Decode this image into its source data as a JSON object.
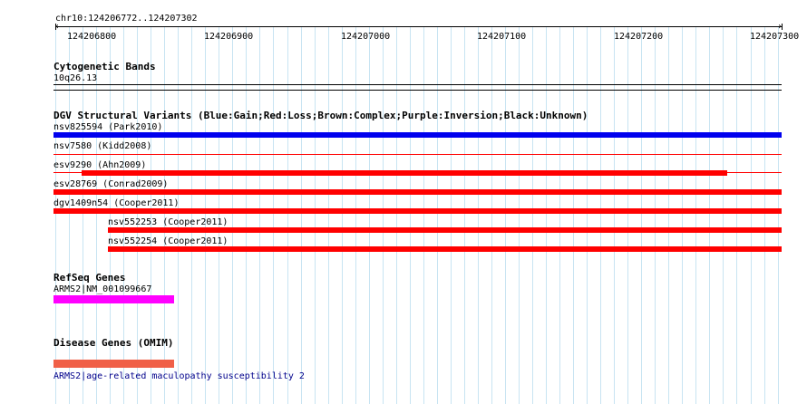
{
  "ruler": {
    "location": "chr10:124206772..124207302",
    "ticks": [
      "124206800",
      "124206900",
      "124207000",
      "124207100",
      "124207200",
      "124207300"
    ]
  },
  "cytoband": {
    "title": "Cytogenetic Bands",
    "band": "10q26.13"
  },
  "dgv": {
    "title": "DGV Structural Variants (Blue:Gain;Red:Loss;Brown:Complex;Purple:Inversion;Black:Unknown)",
    "colors": {
      "gain": "#0000ee",
      "loss": "#ff0000"
    },
    "variants": [
      {
        "label": "nsv825594 (Park2010)",
        "type": "gain"
      },
      {
        "label": "nsv7580 (Kidd2008)",
        "type": "loss"
      },
      {
        "label": "esv9290 (Ahn2009)",
        "type": "loss"
      },
      {
        "label": "esv28769 (Conrad2009)",
        "type": "loss"
      },
      {
        "label": "dgv1409n54 (Cooper2011)",
        "type": "loss"
      },
      {
        "label": "nsv552253 (Cooper2011)",
        "type": "loss"
      },
      {
        "label": "nsv552254 (Cooper2011)",
        "type": "loss"
      }
    ]
  },
  "refseq": {
    "title": "RefSeq Genes",
    "gene_label": "ARMS2|NM_001099667",
    "color": "#ff00ff"
  },
  "disease": {
    "title": "Disease Genes (OMIM)",
    "gene_label": "ARMS2|age-related maculopathy susceptibility 2",
    "color": "#f06048",
    "link_color": "#00008b"
  }
}
